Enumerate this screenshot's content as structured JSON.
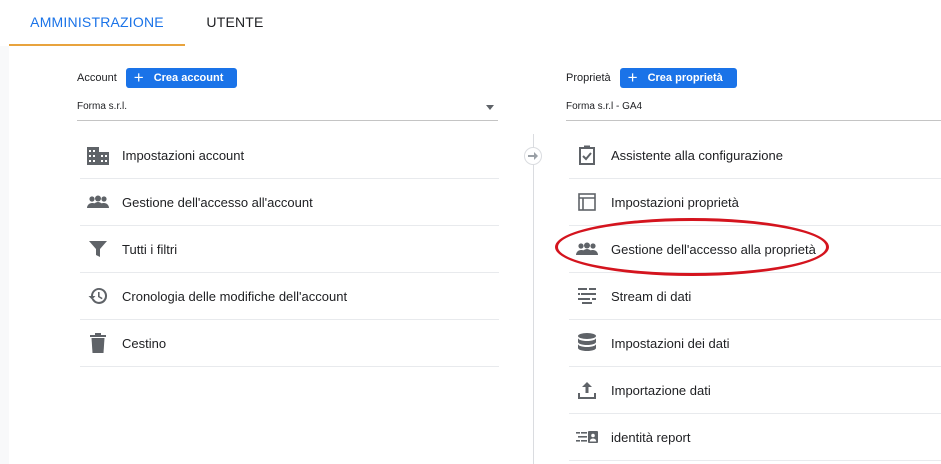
{
  "tabs": [
    {
      "label": "AMMINISTRAZIONE",
      "active": true
    },
    {
      "label": "UTENTE",
      "active": false
    }
  ],
  "account": {
    "label": "Account",
    "create_button": "Crea account",
    "selected": "Forma s.r.l.",
    "items": [
      {
        "label": "Impostazioni account",
        "icon": "building-icon"
      },
      {
        "label": "Gestione dell'accesso all'account",
        "icon": "people-icon"
      },
      {
        "label": "Tutti i filtri",
        "icon": "filter-icon"
      },
      {
        "label": "Cronologia delle modifiche dell'account",
        "icon": "history-icon"
      },
      {
        "label": "Cestino",
        "icon": "trash-icon"
      }
    ]
  },
  "property": {
    "label": "Proprietà",
    "create_button": "Crea proprietà",
    "selected": "Forma s.r.l - GA4",
    "items": [
      {
        "label": "Assistente alla configurazione",
        "icon": "checklist-icon"
      },
      {
        "label": "Impostazioni proprietà",
        "icon": "layout-icon"
      },
      {
        "label": "Gestione dell'accesso alla proprietà",
        "icon": "people-icon"
      },
      {
        "label": "Stream di dati",
        "icon": "stream-icon"
      },
      {
        "label": "Impostazioni dei dati",
        "icon": "database-icon"
      },
      {
        "label": "Importazione dati",
        "icon": "upload-icon"
      },
      {
        "label": "identità report",
        "icon": "report-identity-icon"
      }
    ]
  },
  "colors": {
    "accent": "#1a73e8",
    "tab_underline": "#e8a33d",
    "annotation": "#d4141e",
    "icon": "#5f6368"
  }
}
